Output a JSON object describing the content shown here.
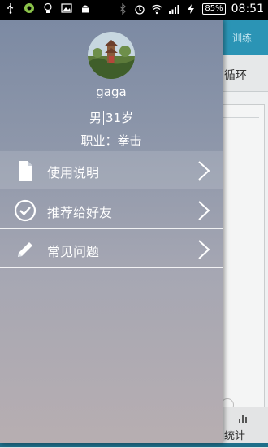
{
  "status_bar": {
    "battery": "85%",
    "time": "08:51"
  },
  "background_app": {
    "tab_label": "训练",
    "sub_label": "循环",
    "bottom_label": "统计"
  },
  "drawer": {
    "profile": {
      "name": "gaga",
      "gender": "男",
      "age": "31岁",
      "occupation": "职业：拳击"
    },
    "menu": [
      {
        "label": "使用说明",
        "icon": "document-icon"
      },
      {
        "label": "推荐给好友",
        "icon": "check-circle-icon"
      },
      {
        "label": "常见问题",
        "icon": "pencil-icon"
      }
    ]
  }
}
